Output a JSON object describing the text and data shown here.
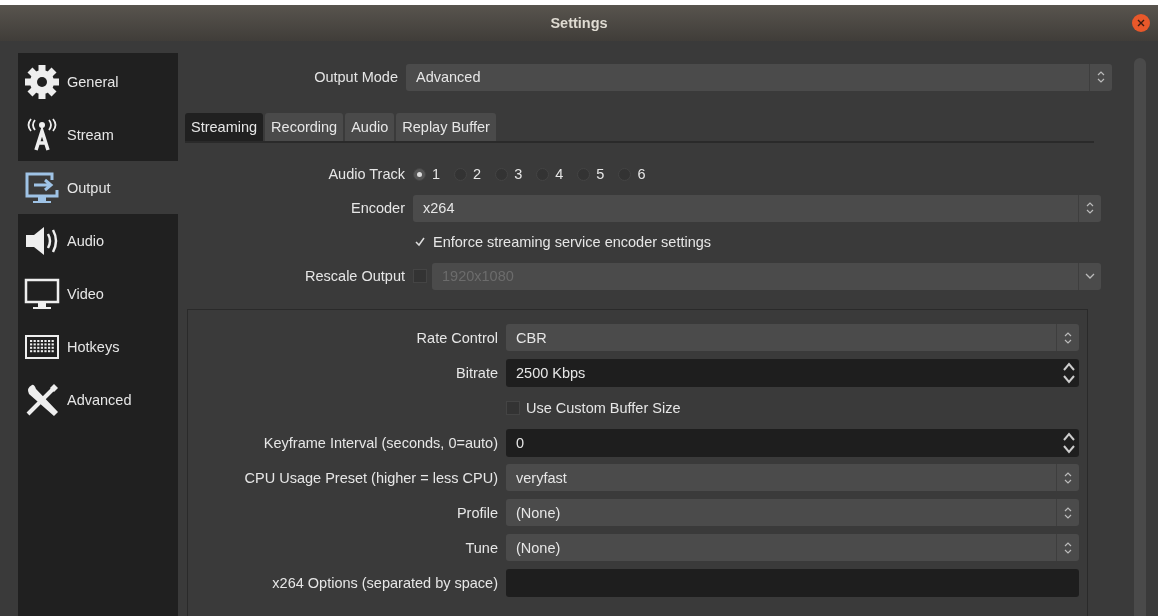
{
  "window": {
    "title": "Settings"
  },
  "sidebar": {
    "items": [
      {
        "label": "General",
        "kind": "gear",
        "selected": false
      },
      {
        "label": "Stream",
        "kind": "antenna",
        "selected": false
      },
      {
        "label": "Output",
        "kind": "output",
        "selected": true
      },
      {
        "label": "Audio",
        "kind": "speaker",
        "selected": false
      },
      {
        "label": "Video",
        "kind": "monitor",
        "selected": false
      },
      {
        "label": "Hotkeys",
        "kind": "keyboard",
        "selected": false
      },
      {
        "label": "Advanced",
        "kind": "tools",
        "selected": false
      }
    ]
  },
  "output_mode": {
    "label": "Output Mode",
    "value": "Advanced"
  },
  "tabs": [
    {
      "label": "Streaming",
      "selected": true
    },
    {
      "label": "Recording",
      "selected": false
    },
    {
      "label": "Audio",
      "selected": false
    },
    {
      "label": "Replay Buffer",
      "selected": false
    }
  ],
  "streaming": {
    "fields": [
      {
        "kind": "radios",
        "label": "Audio Track",
        "options": [
          {
            "label": "1",
            "selected": true
          },
          {
            "label": "2",
            "selected": false
          },
          {
            "label": "3",
            "selected": false
          },
          {
            "label": "4",
            "selected": false
          },
          {
            "label": "5",
            "selected": false
          },
          {
            "label": "6",
            "selected": false
          }
        ]
      },
      {
        "kind": "select",
        "label": "Encoder",
        "value": "x264"
      },
      {
        "kind": "checkbox",
        "label": "Enforce streaming service encoder settings",
        "checked": true
      },
      {
        "kind": "check-select",
        "label": "Rescale Output",
        "checked": false,
        "value": "1920x1080",
        "disabled": true
      }
    ]
  },
  "encoder_settings": {
    "fields": [
      {
        "kind": "select",
        "label": "Rate Control",
        "value": "CBR"
      },
      {
        "kind": "spin",
        "label": "Bitrate",
        "value": "2500 Kbps"
      },
      {
        "kind": "checkbox",
        "label": "Use Custom Buffer Size",
        "checked": false
      },
      {
        "kind": "spin",
        "label": "Keyframe Interval (seconds, 0=auto)",
        "value": "0"
      },
      {
        "kind": "select",
        "label": "CPU Usage Preset (higher = less CPU)",
        "value": "veryfast"
      },
      {
        "kind": "select",
        "label": "Profile",
        "value": "(None)"
      },
      {
        "kind": "select",
        "label": "Tune",
        "value": "(None)"
      },
      {
        "kind": "text",
        "label": "x264 Options (separated by space)"
      }
    ]
  }
}
